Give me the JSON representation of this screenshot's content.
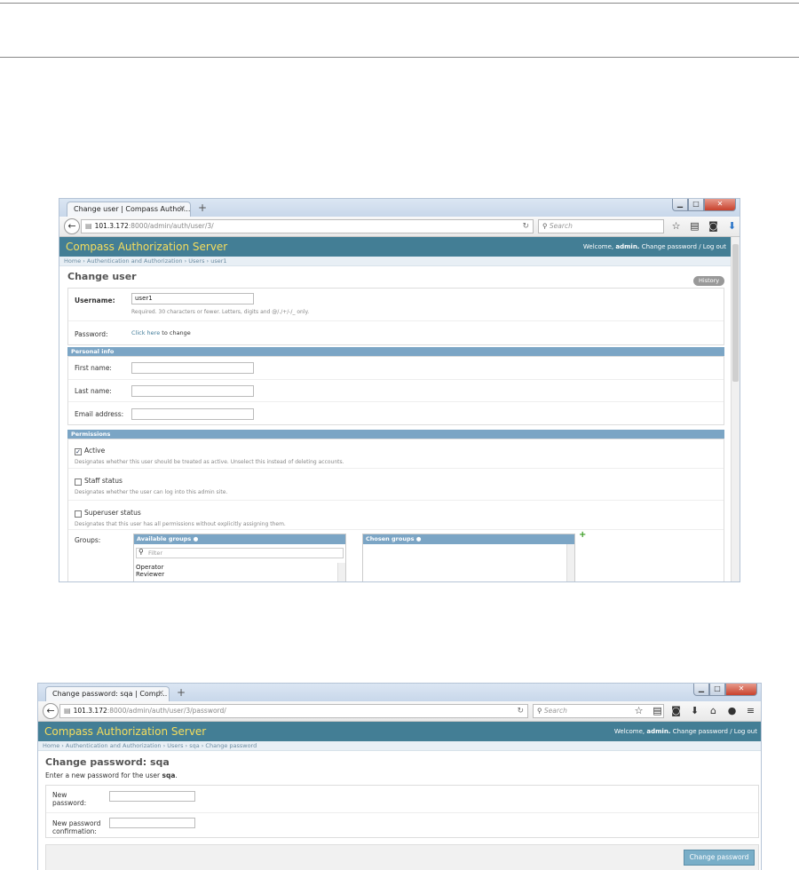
{
  "window1": {
    "tab_title": "Change user | Compass Author...",
    "tab_close": "×",
    "new_tab": "+",
    "url_host": "101.3.172",
    "url_path": ":8000/admin/auth/user/3/",
    "search_placeholder": "Search",
    "site_title": "Compass Authorization Server",
    "welcome": "Welcome,",
    "user": "admin.",
    "change_password": "Change password",
    "separator": "/",
    "logout": "Log out",
    "breadcrumbs": "Home › Authentication and Authorization › Users › user1",
    "page_title": "Change user",
    "history_label": "History",
    "username_label": "Username:",
    "username_value": "user1",
    "username_help": "Required. 30 characters or fewer. Letters, digits and @/./+/-/_ only.",
    "password_label": "Password:",
    "password_link": "Click here",
    "password_suffix": "to change",
    "personal_info_title": "Personal info",
    "first_name_label": "First name:",
    "last_name_label": "Last name:",
    "email_label": "Email address:",
    "permissions_title": "Permissions",
    "active_label": "Active",
    "active_checked": true,
    "active_help": "Designates whether this user should be treated as active. Unselect this instead of deleting accounts.",
    "staff_label": "Staff status",
    "staff_help": "Designates whether the user can log into this admin site.",
    "superuser_label": "Superuser status",
    "superuser_help": "Designates that this user has all permissions without explicitly assigning them.",
    "groups_label": "Groups:",
    "available_groups": "Available groups",
    "filter_placeholder": "Filter",
    "available_options": [
      "Operator",
      "Reviewer"
    ],
    "chosen_groups": "Chosen groups"
  },
  "window2": {
    "tab_title": "Change password: sqa | Comp...",
    "tab_close": "×",
    "new_tab": "+",
    "url_host": "101.3.172",
    "url_path": ":8000/admin/auth/user/3/password/",
    "search_placeholder": "Search",
    "site_title": "Compass Authorization Server",
    "welcome": "Welcome,",
    "user": "admin.",
    "change_password": "Change password",
    "separator": "/",
    "logout": "Log out",
    "breadcrumbs": "Home › Authentication and Authorization › Users › sqa › Change password",
    "page_title": "Change password: sqa",
    "intro_prefix": "Enter a new password for the user",
    "intro_user": "sqa",
    "intro_suffix": ".",
    "new_password_label_1": "New",
    "new_password_label_2": "password:",
    "confirm_label_1": "New password",
    "confirm_label_2": "confirmation:",
    "submit_label": "Change password"
  }
}
